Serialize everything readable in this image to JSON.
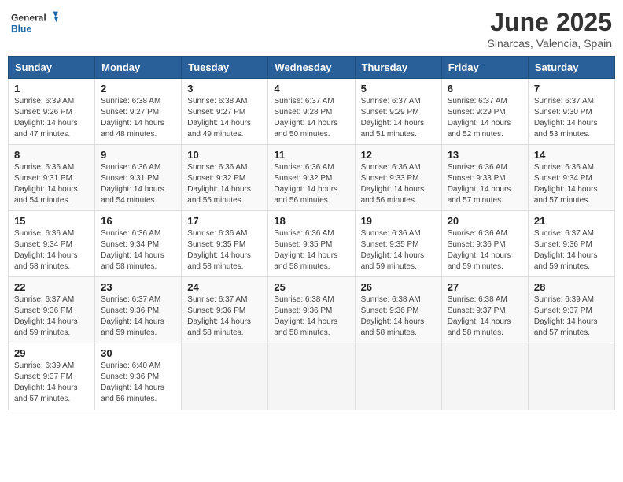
{
  "header": {
    "logo_general": "General",
    "logo_blue": "Blue",
    "month_title": "June 2025",
    "location": "Sinarcas, Valencia, Spain"
  },
  "weekdays": [
    "Sunday",
    "Monday",
    "Tuesday",
    "Wednesday",
    "Thursday",
    "Friday",
    "Saturday"
  ],
  "weeks": [
    [
      {
        "day": "1",
        "sunrise": "6:39 AM",
        "sunset": "9:26 PM",
        "daylight": "14 hours and 47 minutes."
      },
      {
        "day": "2",
        "sunrise": "6:38 AM",
        "sunset": "9:27 PM",
        "daylight": "14 hours and 48 minutes."
      },
      {
        "day": "3",
        "sunrise": "6:38 AM",
        "sunset": "9:27 PM",
        "daylight": "14 hours and 49 minutes."
      },
      {
        "day": "4",
        "sunrise": "6:37 AM",
        "sunset": "9:28 PM",
        "daylight": "14 hours and 50 minutes."
      },
      {
        "day": "5",
        "sunrise": "6:37 AM",
        "sunset": "9:29 PM",
        "daylight": "14 hours and 51 minutes."
      },
      {
        "day": "6",
        "sunrise": "6:37 AM",
        "sunset": "9:29 PM",
        "daylight": "14 hours and 52 minutes."
      },
      {
        "day": "7",
        "sunrise": "6:37 AM",
        "sunset": "9:30 PM",
        "daylight": "14 hours and 53 minutes."
      }
    ],
    [
      {
        "day": "8",
        "sunrise": "6:36 AM",
        "sunset": "9:31 PM",
        "daylight": "14 hours and 54 minutes."
      },
      {
        "day": "9",
        "sunrise": "6:36 AM",
        "sunset": "9:31 PM",
        "daylight": "14 hours and 54 minutes."
      },
      {
        "day": "10",
        "sunrise": "6:36 AM",
        "sunset": "9:32 PM",
        "daylight": "14 hours and 55 minutes."
      },
      {
        "day": "11",
        "sunrise": "6:36 AM",
        "sunset": "9:32 PM",
        "daylight": "14 hours and 56 minutes."
      },
      {
        "day": "12",
        "sunrise": "6:36 AM",
        "sunset": "9:33 PM",
        "daylight": "14 hours and 56 minutes."
      },
      {
        "day": "13",
        "sunrise": "6:36 AM",
        "sunset": "9:33 PM",
        "daylight": "14 hours and 57 minutes."
      },
      {
        "day": "14",
        "sunrise": "6:36 AM",
        "sunset": "9:34 PM",
        "daylight": "14 hours and 57 minutes."
      }
    ],
    [
      {
        "day": "15",
        "sunrise": "6:36 AM",
        "sunset": "9:34 PM",
        "daylight": "14 hours and 58 minutes."
      },
      {
        "day": "16",
        "sunrise": "6:36 AM",
        "sunset": "9:34 PM",
        "daylight": "14 hours and 58 minutes."
      },
      {
        "day": "17",
        "sunrise": "6:36 AM",
        "sunset": "9:35 PM",
        "daylight": "14 hours and 58 minutes."
      },
      {
        "day": "18",
        "sunrise": "6:36 AM",
        "sunset": "9:35 PM",
        "daylight": "14 hours and 58 minutes."
      },
      {
        "day": "19",
        "sunrise": "6:36 AM",
        "sunset": "9:35 PM",
        "daylight": "14 hours and 59 minutes."
      },
      {
        "day": "20",
        "sunrise": "6:36 AM",
        "sunset": "9:36 PM",
        "daylight": "14 hours and 59 minutes."
      },
      {
        "day": "21",
        "sunrise": "6:37 AM",
        "sunset": "9:36 PM",
        "daylight": "14 hours and 59 minutes."
      }
    ],
    [
      {
        "day": "22",
        "sunrise": "6:37 AM",
        "sunset": "9:36 PM",
        "daylight": "14 hours and 59 minutes."
      },
      {
        "day": "23",
        "sunrise": "6:37 AM",
        "sunset": "9:36 PM",
        "daylight": "14 hours and 59 minutes."
      },
      {
        "day": "24",
        "sunrise": "6:37 AM",
        "sunset": "9:36 PM",
        "daylight": "14 hours and 58 minutes."
      },
      {
        "day": "25",
        "sunrise": "6:38 AM",
        "sunset": "9:36 PM",
        "daylight": "14 hours and 58 minutes."
      },
      {
        "day": "26",
        "sunrise": "6:38 AM",
        "sunset": "9:36 PM",
        "daylight": "14 hours and 58 minutes."
      },
      {
        "day": "27",
        "sunrise": "6:38 AM",
        "sunset": "9:37 PM",
        "daylight": "14 hours and 58 minutes."
      },
      {
        "day": "28",
        "sunrise": "6:39 AM",
        "sunset": "9:37 PM",
        "daylight": "14 hours and 57 minutes."
      }
    ],
    [
      {
        "day": "29",
        "sunrise": "6:39 AM",
        "sunset": "9:37 PM",
        "daylight": "14 hours and 57 minutes."
      },
      {
        "day": "30",
        "sunrise": "6:40 AM",
        "sunset": "9:36 PM",
        "daylight": "14 hours and 56 minutes."
      },
      null,
      null,
      null,
      null,
      null
    ]
  ]
}
